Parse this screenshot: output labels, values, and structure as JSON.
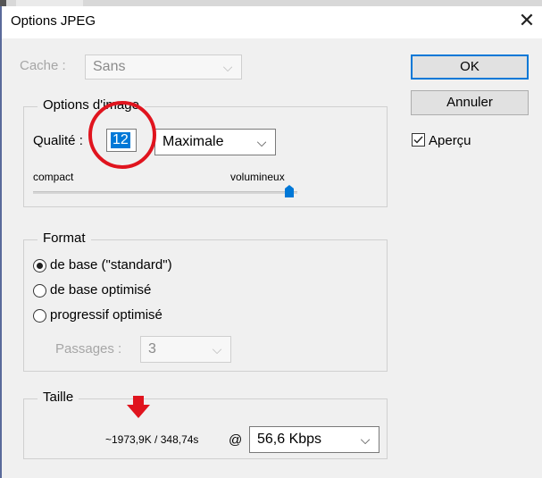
{
  "dialog": {
    "title": "Options JPEG",
    "close_glyph": "✕"
  },
  "cache": {
    "label": "Cache :",
    "value": "Sans"
  },
  "buttons": {
    "ok": "OK",
    "cancel": "Annuler"
  },
  "preview": {
    "label": "Aperçu",
    "checked": true
  },
  "image_options": {
    "legend": "Options d'image",
    "quality_label": "Qualité :",
    "quality_value": "12",
    "quality_preset": "Maximale",
    "slider_left_label": "compact",
    "slider_right_label": "volumineux",
    "slider_level_fraction": 1.0
  },
  "format": {
    "legend": "Format",
    "options": [
      {
        "label": "de base  (\"standard\")",
        "selected": true
      },
      {
        "label": "de base optimisé",
        "selected": false
      },
      {
        "label": "progressif optimisé",
        "selected": false
      }
    ],
    "passes_label": "Passages :",
    "passes_value": "3"
  },
  "size": {
    "legend": "Taille",
    "estimate": "~1973,9K / 348,74s",
    "at_symbol": "@",
    "speed_value": "56,6 Kbps"
  },
  "annotations": {
    "circle_color": "#e0141e",
    "arrow_color": "#e0141e"
  },
  "icons": {
    "close": "close-icon",
    "chevron": "chevron-down-icon",
    "slider_thumb": "slider-thumb-icon",
    "check": "checkmark-icon"
  }
}
